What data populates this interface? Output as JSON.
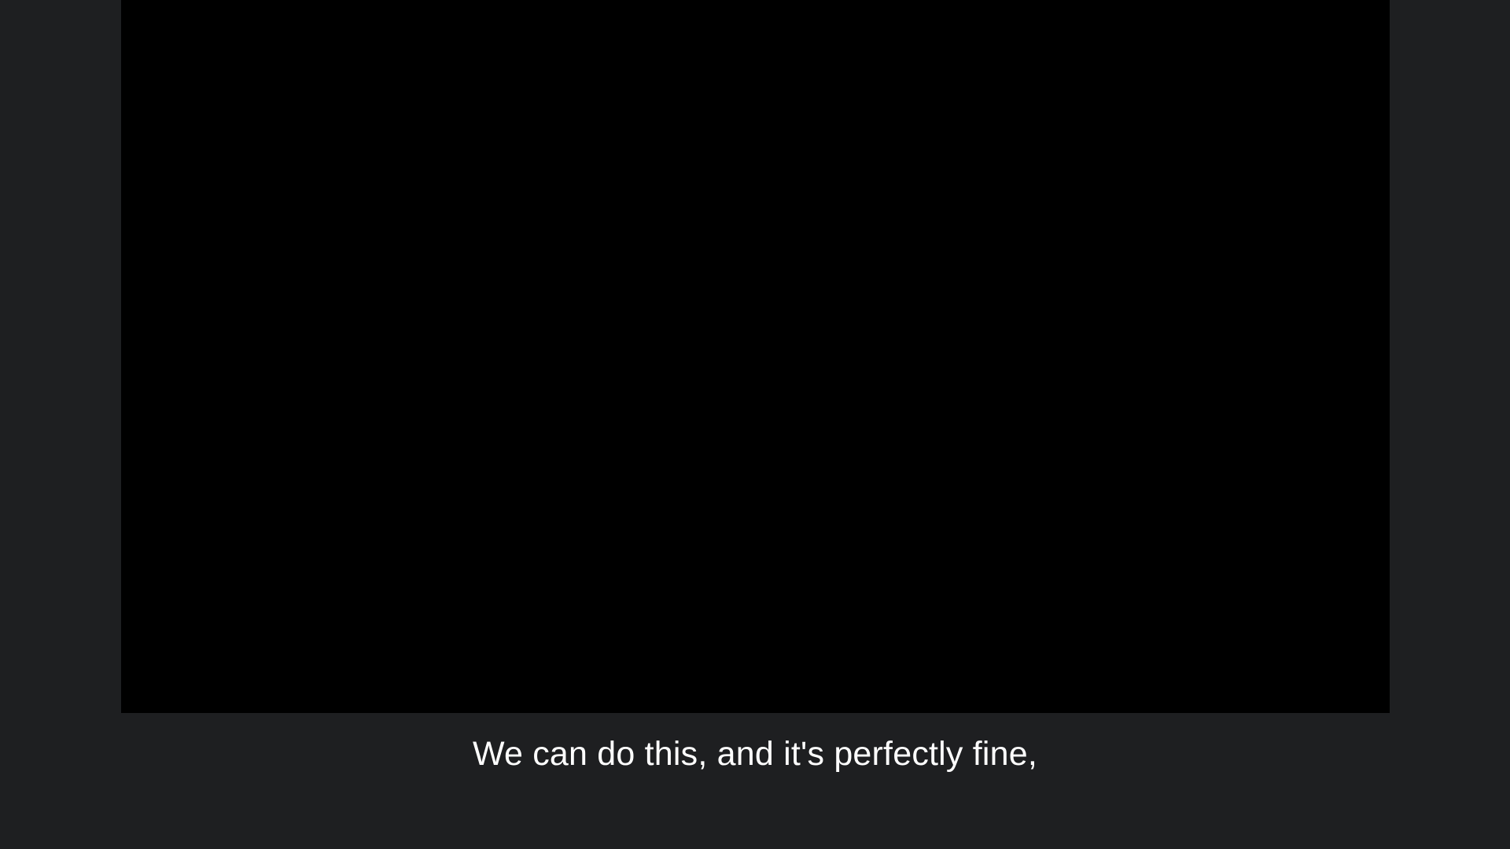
{
  "player": {
    "background_color": "#1e1f21",
    "video_color": "#000000"
  },
  "caption": {
    "text": "We can do this, and it's perfectly fine,",
    "color": "#ffffff"
  }
}
